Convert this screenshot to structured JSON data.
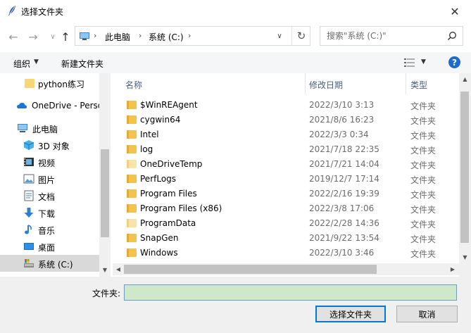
{
  "window": {
    "title": "选择文件夹",
    "close_glyph": "✕"
  },
  "nav_buttons": {
    "back": "←",
    "forward": "→",
    "recent": "∨",
    "up": "↑"
  },
  "address": {
    "crumbs": [
      "此电脑",
      "系统 (C:)"
    ],
    "separator": "›",
    "dropdown": "∨",
    "refresh": "↻"
  },
  "search": {
    "placeholder": "搜索\"系统 (C:)\""
  },
  "toolbar": {
    "organize": "组织",
    "organize_caret": "▼",
    "new_folder": "新建文件夹",
    "view_caret": "▼",
    "help": "?"
  },
  "nav_pane": {
    "items": [
      {
        "label": "python练习",
        "icon": "folder-icon"
      },
      {
        "label": "OneDrive - Personal",
        "icon": "cloud-icon"
      },
      {
        "label": "此电脑",
        "icon": "computer-icon"
      },
      {
        "label": "3D 对象",
        "icon": "cube-icon"
      },
      {
        "label": "视频",
        "icon": "video-icon"
      },
      {
        "label": "图片",
        "icon": "picture-icon"
      },
      {
        "label": "文档",
        "icon": "document-icon"
      },
      {
        "label": "下载",
        "icon": "download-icon"
      },
      {
        "label": "音乐",
        "icon": "music-icon"
      },
      {
        "label": "桌面",
        "icon": "desktop-icon"
      },
      {
        "label": "系统 (C:)",
        "icon": "drive-icon"
      }
    ],
    "scroll_down": "▼"
  },
  "file_list": {
    "columns": {
      "name": "名称",
      "modified": "修改日期",
      "type": "类型"
    },
    "sort_caret": "^",
    "rows": [
      {
        "name": "$WinREAgent",
        "date": "2022/3/10 3:13",
        "type": "文件夹"
      },
      {
        "name": "cygwin64",
        "date": "2021/8/6 16:23",
        "type": "文件夹"
      },
      {
        "name": "Intel",
        "date": "2022/3/3 0:34",
        "type": "文件夹"
      },
      {
        "name": "log",
        "date": "2021/7/18 22:35",
        "type": "文件夹"
      },
      {
        "name": "OneDriveTemp",
        "date": "2021/7/21 14:04",
        "type": "文件夹"
      },
      {
        "name": "PerfLogs",
        "date": "2019/12/7 17:14",
        "type": "文件夹"
      },
      {
        "name": "Program Files",
        "date": "2022/2/16 19:39",
        "type": "文件夹"
      },
      {
        "name": "Program Files (x86)",
        "date": "2022/3/8 17:06",
        "type": "文件夹"
      },
      {
        "name": "ProgramData",
        "date": "2022/2/28 14:36",
        "type": "文件夹"
      },
      {
        "name": "SnapGen",
        "date": "2021/9/22 13:54",
        "type": "文件夹"
      },
      {
        "name": "Windows",
        "date": "2022/3/10 3:46",
        "type": "文件夹"
      }
    ],
    "scroll_up": "▲",
    "scroll_down": "▼",
    "scroll_left": "◀",
    "scroll_right": "▶"
  },
  "bottom": {
    "folder_label": "文件夹:",
    "folder_value": "",
    "select_button": "选择文件夹",
    "cancel_button": "取消"
  },
  "colors": {
    "accent": "#0078d7",
    "folder_yellow": "#f3c24f",
    "input_bg": "#cfe8c9",
    "help_blue": "#1e6bd0"
  }
}
